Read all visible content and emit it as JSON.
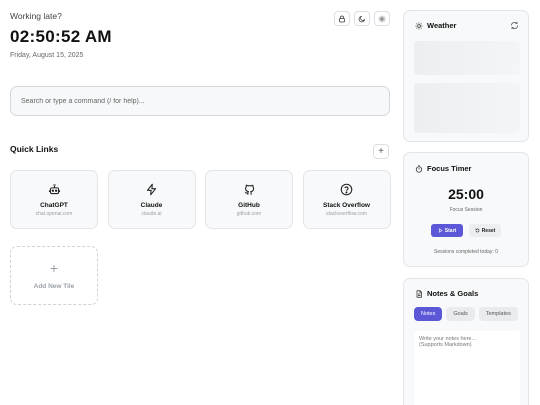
{
  "header": {
    "greeting": "Working late?",
    "time": "02:50:52 AM",
    "date": "Friday, August 15, 2025",
    "icons": [
      "lock-icon",
      "moon-icon",
      "gear-icon"
    ]
  },
  "search": {
    "placeholder": "Search or type a command (/ for help)..."
  },
  "quick_links": {
    "title": "Quick Links",
    "add_label": "+",
    "tiles": [
      {
        "name": "ChatGPT",
        "url": "chat.openai.com",
        "icon": "robot-icon"
      },
      {
        "name": "Claude",
        "url": "claude.ai",
        "icon": "lightning-icon"
      },
      {
        "name": "GitHub",
        "url": "github.com",
        "icon": "github-icon"
      },
      {
        "name": "Stack Overflow",
        "url": "stackoverflow.com",
        "icon": "help-circle-icon"
      }
    ],
    "add_tile": {
      "plus": "+",
      "label": "Add New Tile"
    }
  },
  "weather": {
    "title": "Weather",
    "icon": "sun-icon",
    "refresh_icon": "refresh-icon"
  },
  "focus_timer": {
    "title": "Focus Timer",
    "icon": "timer-icon",
    "time": "25:00",
    "session_label": "Focus Session",
    "start_label": "Start",
    "reset_label": "Reset",
    "sessions_text": "Sessions completed today: 0",
    "accent": "#5b57d6"
  },
  "notes": {
    "title": "Notes & Goals",
    "icon": "notes-icon",
    "tabs": [
      "Notes",
      "Goals",
      "Templates"
    ],
    "active_tab": "Notes",
    "placeholder": "Write your notes here...\n(Supports Markdown)"
  }
}
